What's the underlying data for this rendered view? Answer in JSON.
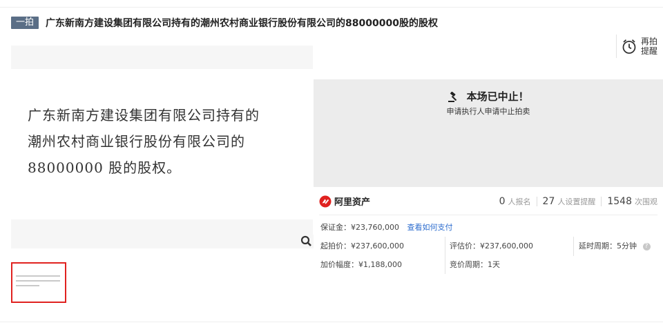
{
  "header": {
    "badge": "一拍",
    "title": "广东新南方建设集团有限公司持有的潮州农村商业银行股份有限公司的88000000股的股权"
  },
  "remind": {
    "label": "再拍提醒",
    "icon": "alarm-clock-icon"
  },
  "gallery": {
    "document_lines": [
      "广东新南方建设集团有限公司持有的",
      "潮州农村商业银行股份有限公司的",
      "88000000 股的股权。"
    ],
    "zoom_icon": "magnifier-icon",
    "thumbnail_count": 1
  },
  "status": {
    "title": "本场已中止！",
    "subtitle": "申请执行人申请中止拍卖",
    "icon": "gavel-icon"
  },
  "platform": {
    "name": "阿里资产",
    "logo": "ali-logo-icon",
    "brand_color": "#e0211f"
  },
  "stats": {
    "signups_num": "0",
    "signups_label": "人报名",
    "reminders_num": "27",
    "reminders_label": "人设置提醒",
    "views_num": "1548",
    "views_label": "次围观"
  },
  "info": {
    "deposit": "保证金：¥23,760,000",
    "payment_link": "查看如何支付",
    "start_price": "起拍价：¥237,600,000",
    "appraisal": "评估价：¥237,600,000",
    "delay": "延时周期：5分钟",
    "increment": "加价幅度：¥1,188,000",
    "bidding_period": "竞价周期：1天"
  }
}
